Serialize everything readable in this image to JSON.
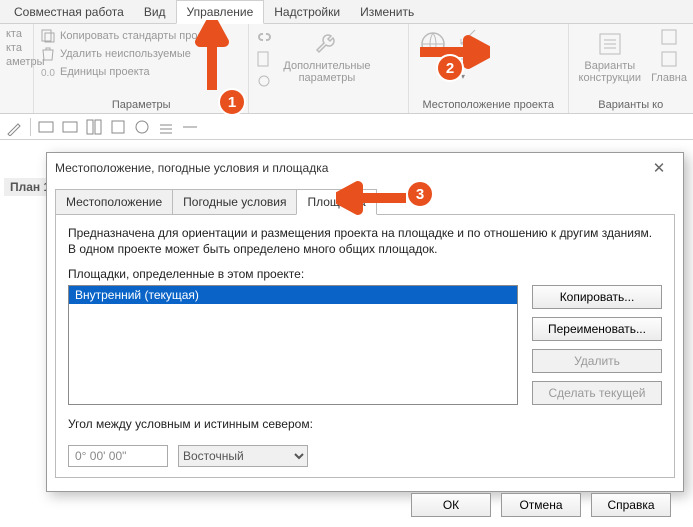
{
  "ribbon": {
    "tabs": [
      "Совместная работа",
      "Вид",
      "Управление",
      "Надстройки",
      "Изменить"
    ],
    "active_tab_index": 2,
    "group_copy": {
      "items": [
        "кта",
        "Копировать стандарты проекта",
        "Удалить неиспользуемые",
        "Единицы проекта"
      ],
      "left_col": [
        "кта",
        "кта",
        "аметры"
      ],
      "label": "Параметры"
    },
    "group_extra": {
      "label": "Дополнительные\nпараметры"
    },
    "group_location": {
      "label": "Местоположение проекта"
    },
    "group_variants": {
      "big": "Варианты\nконструкции",
      "label": "Варианты ко",
      "right": "Главна"
    }
  },
  "plan_label": "План 1",
  "dialog": {
    "title": "Местоположение, погодные условия и площадка",
    "tabs": [
      "Местоположение",
      "Погодные условия",
      "Площадка"
    ],
    "active_tab_index": 2,
    "description": "Предназначена для ориентации и размещения проекта на площадке и по отношению к другим зданиям. В одном проекте может быть определено много общих площадок.",
    "sites_label": "Площадки, определенные в этом проекте:",
    "sites": [
      "Внутренний (текущая)"
    ],
    "selected_site_index": 0,
    "buttons": {
      "copy": "Копировать...",
      "rename": "Переименовать...",
      "delete": "Удалить",
      "make_current": "Сделать текущей"
    },
    "angle_label": "Угол между условным и истинным севером:",
    "angle_value": "0° 00' 00\"",
    "angle_dir": "Восточный",
    "ok": "ОК",
    "cancel": "Отмена",
    "help": "Справка"
  },
  "annotations": {
    "1": "1",
    "2": "2",
    "3": "3"
  }
}
